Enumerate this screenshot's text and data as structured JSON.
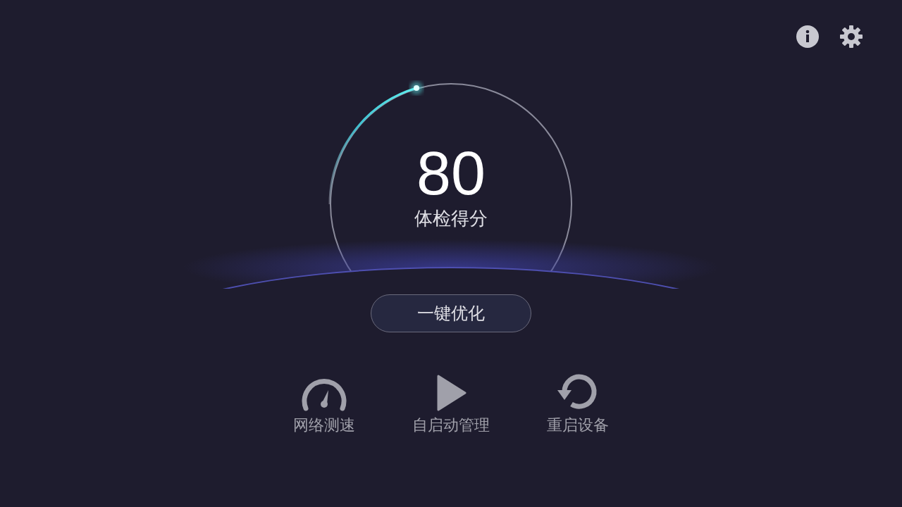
{
  "score": {
    "value": "80",
    "label": "体检得分"
  },
  "optimize_button": {
    "label": "一键优化"
  },
  "actions": [
    {
      "kind": "speedometer",
      "label": "网络测速"
    },
    {
      "kind": "play",
      "label": "自启动管理"
    },
    {
      "kind": "restart",
      "label": "重启设备"
    }
  ]
}
